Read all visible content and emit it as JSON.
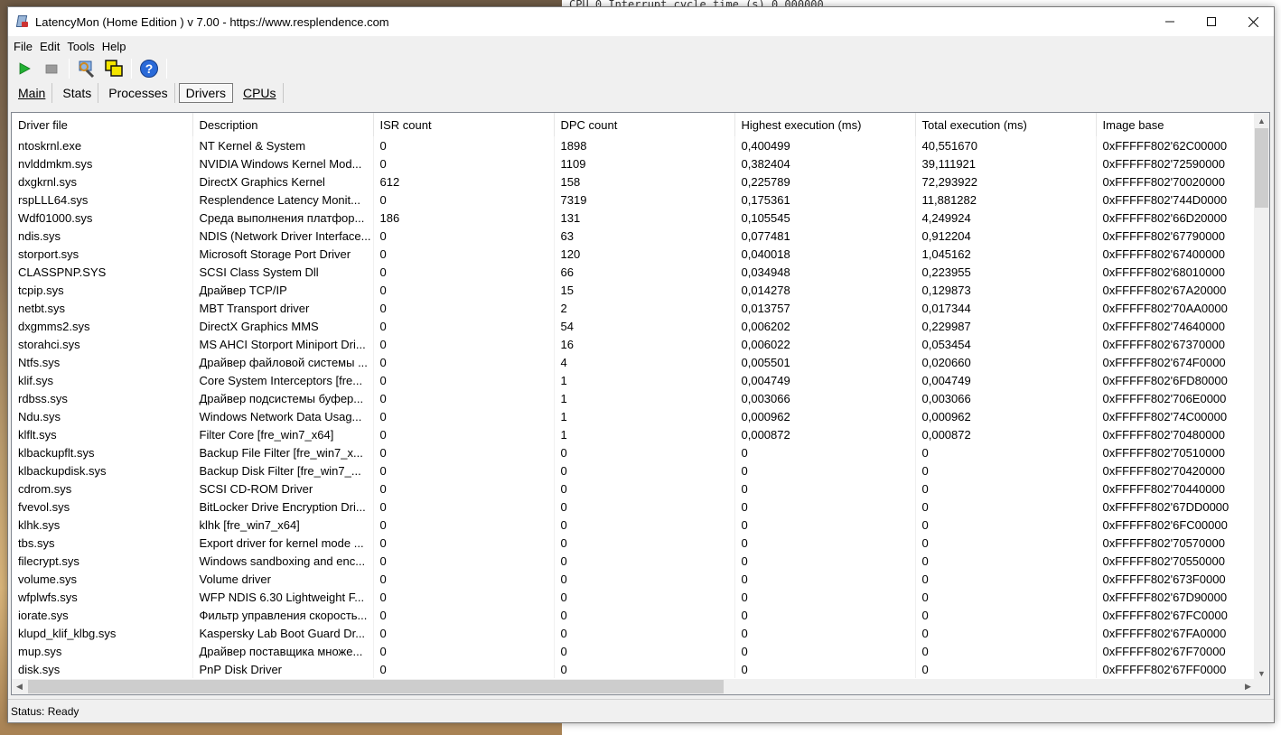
{
  "window": {
    "title": "LatencyMon  (Home Edition )  v 7.00 - https://www.resplendence.com"
  },
  "background_text": "CPU 0 Interrupt cycle time (s)                 0.000000",
  "menu": [
    {
      "label": "File"
    },
    {
      "label": "Edit"
    },
    {
      "label": "Tools"
    },
    {
      "label": "Help"
    }
  ],
  "toolbar": {
    "icons": [
      "play-icon",
      "stop-icon",
      "inspect-icon",
      "windows-icon",
      "help-icon"
    ]
  },
  "tabs": [
    {
      "label": "Main",
      "active": false
    },
    {
      "label": "Stats",
      "active": false
    },
    {
      "label": "Processes",
      "active": false
    },
    {
      "label": "Drivers",
      "active": true
    },
    {
      "label": "CPUs",
      "active": false
    }
  ],
  "table": {
    "columns": [
      "Driver file",
      "Description",
      "ISR count",
      "DPC count",
      "Highest execution (ms)",
      "Total execution (ms)",
      "Image base"
    ],
    "rows": [
      [
        "ntoskrnl.exe",
        "NT Kernel & System",
        "0",
        "1898",
        "0,400499",
        "40,551670",
        "0xFFFFF802'62C00000"
      ],
      [
        "nvlddmkm.sys",
        "NVIDIA Windows Kernel Mod...",
        "0",
        "1109",
        "0,382404",
        "39,111921",
        "0xFFFFF802'72590000"
      ],
      [
        "dxgkrnl.sys",
        "DirectX Graphics Kernel",
        "612",
        "158",
        "0,225789",
        "72,293922",
        "0xFFFFF802'70020000"
      ],
      [
        "rspLLL64.sys",
        "Resplendence Latency Monit...",
        "0",
        "7319",
        "0,175361",
        "11,881282",
        "0xFFFFF802'744D0000"
      ],
      [
        "Wdf01000.sys",
        "Среда выполнения платфор...",
        "186",
        "131",
        "0,105545",
        "4,249924",
        "0xFFFFF802'66D20000"
      ],
      [
        "ndis.sys",
        "NDIS (Network Driver Interface...",
        "0",
        "63",
        "0,077481",
        "0,912204",
        "0xFFFFF802'67790000"
      ],
      [
        "storport.sys",
        "Microsoft Storage Port Driver",
        "0",
        "120",
        "0,040018",
        "1,045162",
        "0xFFFFF802'67400000"
      ],
      [
        "CLASSPNP.SYS",
        "SCSI Class System Dll",
        "0",
        "66",
        "0,034948",
        "0,223955",
        "0xFFFFF802'68010000"
      ],
      [
        "tcpip.sys",
        "Драйвер TCP/IP",
        "0",
        "15",
        "0,014278",
        "0,129873",
        "0xFFFFF802'67A20000"
      ],
      [
        "netbt.sys",
        "MBT Transport driver",
        "0",
        "2",
        "0,013757",
        "0,017344",
        "0xFFFFF802'70AA0000"
      ],
      [
        "dxgmms2.sys",
        "DirectX Graphics MMS",
        "0",
        "54",
        "0,006202",
        "0,229987",
        "0xFFFFF802'74640000"
      ],
      [
        "storahci.sys",
        "MS AHCI Storport Miniport Dri...",
        "0",
        "16",
        "0,006022",
        "0,053454",
        "0xFFFFF802'67370000"
      ],
      [
        "Ntfs.sys",
        "Драйвер файловой системы ...",
        "0",
        "4",
        "0,005501",
        "0,020660",
        "0xFFFFF802'674F0000"
      ],
      [
        "klif.sys",
        "Core System Interceptors [fre...",
        "0",
        "1",
        "0,004749",
        "0,004749",
        "0xFFFFF802'6FD80000"
      ],
      [
        "rdbss.sys",
        "Драйвер подсистемы буфер...",
        "0",
        "1",
        "0,003066",
        "0,003066",
        "0xFFFFF802'706E0000"
      ],
      [
        "Ndu.sys",
        "Windows Network Data Usag...",
        "0",
        "1",
        "0,000962",
        "0,000962",
        "0xFFFFF802'74C00000"
      ],
      [
        "klflt.sys",
        "Filter Core [fre_win7_x64]",
        "0",
        "1",
        "0,000872",
        "0,000872",
        "0xFFFFF802'70480000"
      ],
      [
        "klbackupflt.sys",
        "Backup File Filter [fre_win7_x...",
        "0",
        "0",
        "0",
        "0",
        "0xFFFFF802'70510000"
      ],
      [
        "klbackupdisk.sys",
        "Backup Disk Filter [fre_win7_...",
        "0",
        "0",
        "0",
        "0",
        "0xFFFFF802'70420000"
      ],
      [
        "cdrom.sys",
        "SCSI CD-ROM Driver",
        "0",
        "0",
        "0",
        "0",
        "0xFFFFF802'70440000"
      ],
      [
        "fvevol.sys",
        "BitLocker Drive Encryption Dri...",
        "0",
        "0",
        "0",
        "0",
        "0xFFFFF802'67DD0000"
      ],
      [
        "klhk.sys",
        "klhk [fre_win7_x64]",
        "0",
        "0",
        "0",
        "0",
        "0xFFFFF802'6FC00000"
      ],
      [
        "tbs.sys",
        "Export driver for kernel mode ...",
        "0",
        "0",
        "0",
        "0",
        "0xFFFFF802'70570000"
      ],
      [
        "filecrypt.sys",
        "Windows sandboxing and enc...",
        "0",
        "0",
        "0",
        "0",
        "0xFFFFF802'70550000"
      ],
      [
        "volume.sys",
        "Volume driver",
        "0",
        "0",
        "0",
        "0",
        "0xFFFFF802'673F0000"
      ],
      [
        "wfplwfs.sys",
        "WFP NDIS 6.30 Lightweight F...",
        "0",
        "0",
        "0",
        "0",
        "0xFFFFF802'67D90000"
      ],
      [
        "iorate.sys",
        "Фильтр управления скорость...",
        "0",
        "0",
        "0",
        "0",
        "0xFFFFF802'67FC0000"
      ],
      [
        "klupd_klif_klbg.sys",
        "Kaspersky Lab Boot Guard Dr...",
        "0",
        "0",
        "0",
        "0",
        "0xFFFFF802'67FA0000"
      ],
      [
        "mup.sys",
        "Драйвер поставщика множе...",
        "0",
        "0",
        "0",
        "0",
        "0xFFFFF802'67F70000"
      ],
      [
        "disk.sys",
        "PnP Disk Driver",
        "0",
        "0",
        "0",
        "0",
        "0xFFFFF802'67FF0000"
      ]
    ]
  },
  "status": {
    "text": "Status: Ready"
  }
}
